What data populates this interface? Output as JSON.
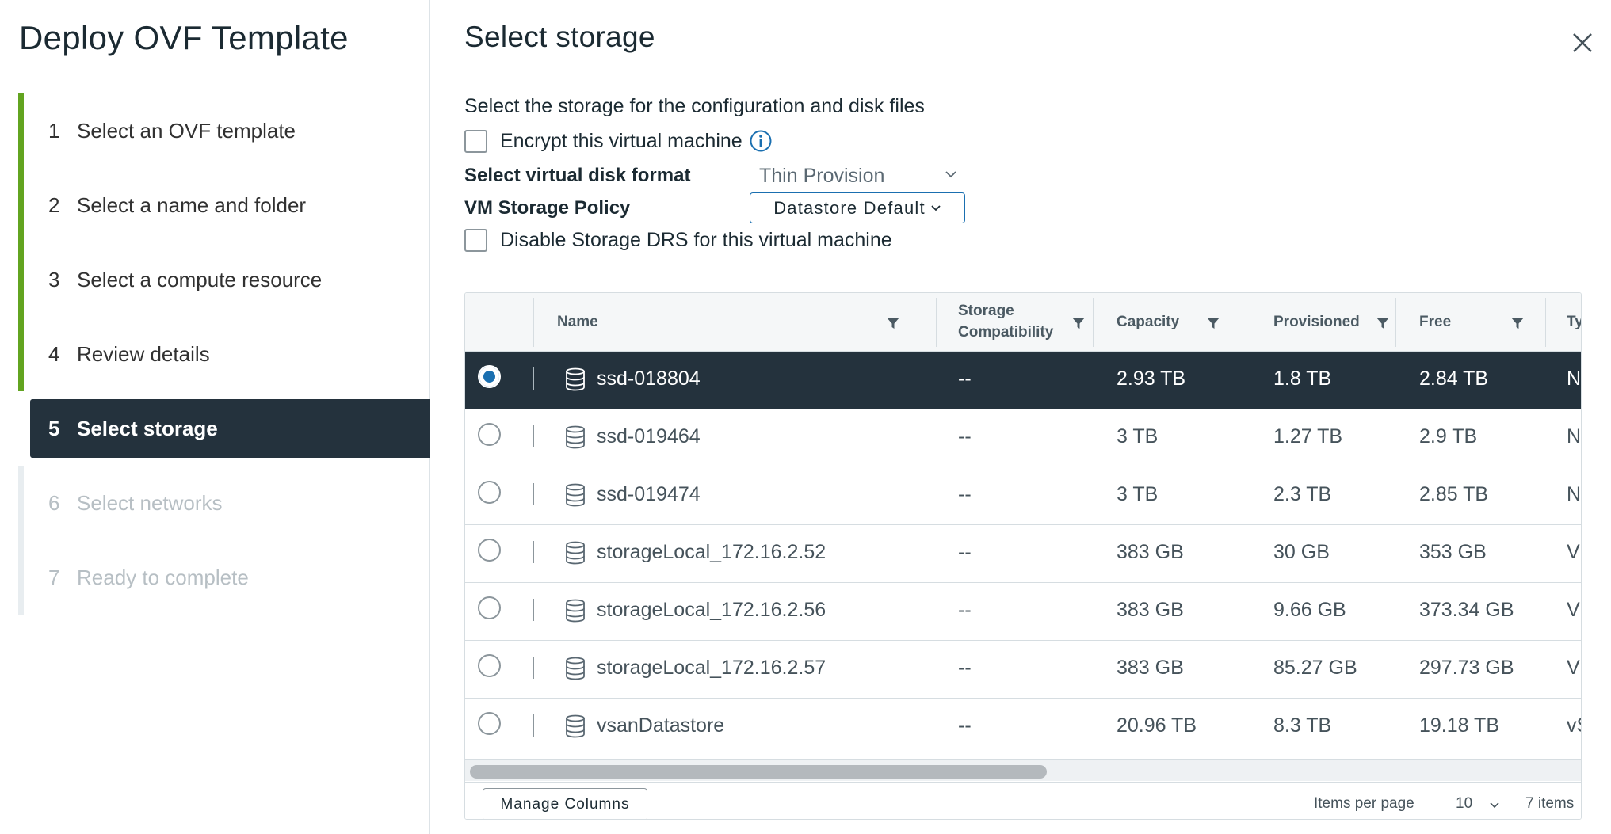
{
  "wizard": {
    "title": "Deploy OVF Template",
    "steps": [
      {
        "num": "1",
        "label": "Select an OVF template"
      },
      {
        "num": "2",
        "label": "Select a name and folder"
      },
      {
        "num": "3",
        "label": "Select a compute resource"
      },
      {
        "num": "4",
        "label": "Review details"
      },
      {
        "num": "5",
        "label": "Select storage"
      },
      {
        "num": "6",
        "label": "Select networks"
      },
      {
        "num": "7",
        "label": "Ready to complete"
      }
    ]
  },
  "page": {
    "title": "Select storage",
    "instruction": "Select the storage for the configuration and disk files",
    "encrypt_label": "Encrypt this virtual machine",
    "disk_format_label": "Select virtual disk format",
    "disk_format_value": "Thin Provision",
    "policy_label": "VM Storage Policy",
    "policy_value": "Datastore Default",
    "disable_drs_label": "Disable Storage DRS for this virtual machine"
  },
  "grid": {
    "columns": {
      "name": "Name",
      "compat_line1": "Storage",
      "compat_line2": "Compatibility",
      "capacity": "Capacity",
      "provisioned": "Provisioned",
      "free": "Free",
      "type": "Ty"
    },
    "rows": [
      {
        "name": "ssd-018804",
        "compat": "--",
        "capacity": "2.93 TB",
        "provisioned": "1.8 TB",
        "free": "2.84 TB",
        "type": "NF"
      },
      {
        "name": "ssd-019464",
        "compat": "--",
        "capacity": "3 TB",
        "provisioned": "1.27 TB",
        "free": "2.9 TB",
        "type": "NF"
      },
      {
        "name": "ssd-019474",
        "compat": "--",
        "capacity": "3 TB",
        "provisioned": "2.3 TB",
        "free": "2.85 TB",
        "type": "NF"
      },
      {
        "name": "storageLocal_172.16.2.52",
        "compat": "--",
        "capacity": "383 GB",
        "provisioned": "30 GB",
        "free": "353 GB",
        "type": "VI"
      },
      {
        "name": "storageLocal_172.16.2.56",
        "compat": "--",
        "capacity": "383 GB",
        "provisioned": "9.66 GB",
        "free": "373.34 GB",
        "type": "VI"
      },
      {
        "name": "storageLocal_172.16.2.57",
        "compat": "--",
        "capacity": "383 GB",
        "provisioned": "85.27 GB",
        "free": "297.73 GB",
        "type": "VI"
      },
      {
        "name": "vsanDatastore",
        "compat": "--",
        "capacity": "20.96 TB",
        "provisioned": "8.3 TB",
        "free": "19.18 TB",
        "type": "vS"
      }
    ],
    "footer": {
      "manage_columns": "Manage Columns",
      "items_per_page_label": "Items per page",
      "items_per_page_value": "10",
      "items_count": "7 items"
    }
  },
  "colors": {
    "accent_blue": "#1a6fb0",
    "completed_step": "#62a420",
    "selected_bg": "#24323d"
  }
}
